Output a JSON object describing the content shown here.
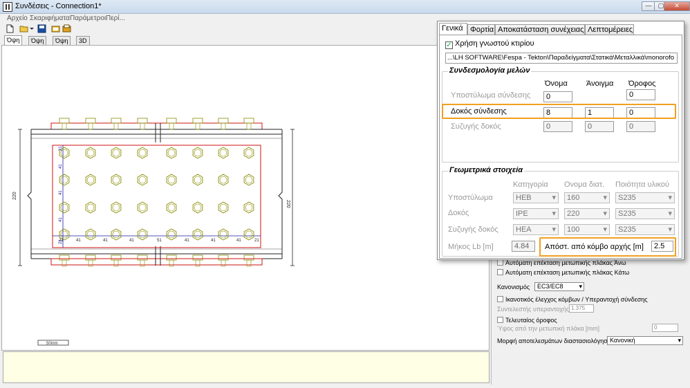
{
  "window": {
    "title": "Συνδέσεις - Connection1*",
    "minimize": "—",
    "maximize": "▢",
    "close": "✕"
  },
  "menu": [
    "Αρχείο",
    "Σκαριφήματα",
    "Παράμετροι",
    "Περί..."
  ],
  "view_tabs": [
    "Όψη Α",
    "Όψη Β",
    "Όψη Γ",
    "3D"
  ],
  "drawing": {
    "dimension_left": "220",
    "dimension_right": "220",
    "scale_label": "50mm",
    "spacing_labels": [
      "21",
      "41",
      "41",
      "41",
      "51",
      "41",
      "41",
      "41",
      "21"
    ],
    "vertical_labels": [
      "21",
      "41",
      "41",
      "41",
      "21"
    ]
  },
  "right_panel": {
    "auto_top": "Αυτόματη επέκταση μετωπικής πλάκας Άνω",
    "auto_bottom": "Αυτόματη επέκταση μετωπικής πλάκας Κάτω",
    "code_label": "Κανονισμός",
    "code_value": "EC3/EC8",
    "capacity_check": "Ικανοτικός έλεγχος κόμβων / Υπεραντοχή σύνδεσης",
    "overstrength_label": "Συντελεστής υπεραντοχής",
    "overstrength_value": "1.375",
    "last_floor": "Τελευταίος όροφος",
    "height_label": "Ύψος από την μετωπική πλάκα [mm]",
    "height_value": "0",
    "results_label": "Μορφή αποτελεσμάτων διαστασιολόγησης",
    "results_value": "Κανονική"
  },
  "dialog": {
    "tabs": [
      "Γενικά",
      "Φορτία",
      "Αποκατάσταση συνέχειας",
      "Λεπτομέρειες"
    ],
    "use_building_label": "Χρήση γνωστού κτιρίου",
    "use_building_checked": "✓",
    "path": "...\\LH SOFTWARE\\Fespa - Tekton\\Παραδείγματα\\Στατικά\\Μεταλλικά\\monorofo",
    "members": {
      "title": "Συνδεσμολογία μελών",
      "col_name": "Όνομα",
      "col_opening": "Άνοιγμα",
      "col_floor": "Όροφος",
      "rows": [
        {
          "label": "Υποστύλωμα σύνδεσης",
          "name": "0",
          "opening": "",
          "floor": "0"
        },
        {
          "label": "Δοκός σύνδεσης",
          "name": "8",
          "opening": "1",
          "floor": "0"
        },
        {
          "label": "Συζυγής δοκός",
          "name": "0",
          "opening": "0",
          "floor": "0"
        }
      ]
    },
    "geometry": {
      "title": "Γεωμετρικά στοιχεία",
      "col_category": "Κατηγορία",
      "col_section": "Ονομα διατ.",
      "col_material": "Ποιότητα υλικού",
      "rows": [
        {
          "label": "Υποστύλωμα",
          "category": "HEB",
          "section": "160",
          "material": "S235"
        },
        {
          "label": "Δοκός",
          "category": "IPE",
          "section": "220",
          "material": "S235"
        },
        {
          "label": "Συζυγής δοκός",
          "category": "HEA",
          "section": "100",
          "material": "S235"
        }
      ],
      "length_label": "Μήκος Lb [m]",
      "length_value": "4.84",
      "distance_label": "Απόστ. από κόμβο αρχής [m]",
      "distance_value": "2.5"
    }
  },
  "colors": {
    "highlight": "#f0a020",
    "plate": "#d01010",
    "bolt": "#8a8a00",
    "axis": "#1a1aa0"
  }
}
